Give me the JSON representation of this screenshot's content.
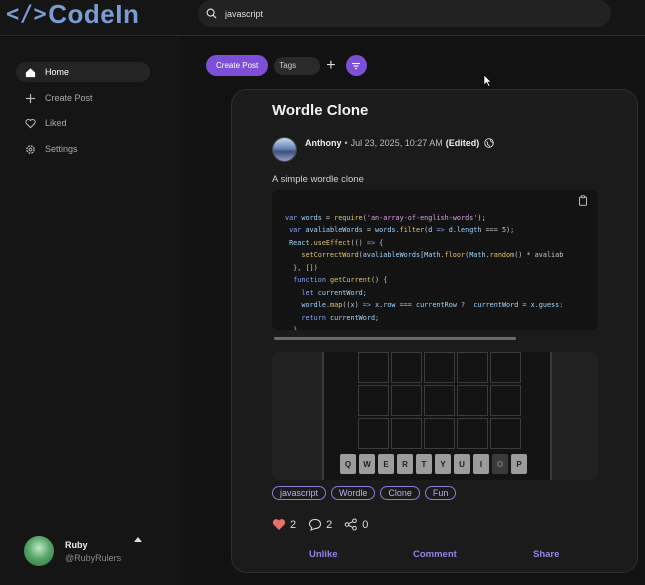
{
  "app": {
    "logo_text": "CodeIn",
    "logo_bracket": "</>"
  },
  "search": {
    "value": "javascript"
  },
  "sidebar": {
    "items": [
      {
        "label": "Home",
        "icon": "home-icon",
        "active": true
      },
      {
        "label": "Create Post",
        "icon": "plus-icon"
      },
      {
        "label": "Liked",
        "icon": "heart-icon"
      },
      {
        "label": "Settings",
        "icon": "gear-icon"
      }
    ],
    "user": {
      "name": "Ruby",
      "handle": "@RubyRulers"
    }
  },
  "toolbar": {
    "create_label": "Create Post",
    "tags_label": "Tags",
    "plus_label": "+"
  },
  "post": {
    "title": "Wordle Clone",
    "author": "Anthony",
    "separator": "•",
    "date": "Jul 23, 2025, 10:27 AM",
    "edited": "(Edited)",
    "description": "A simple wordle clone",
    "code_lines": [
      "var words = require('an-array-of-english-words');",
      " var avaliableWords = words.filter(d => d.length === 5);",
      " React.useEffect(() => {",
      "    setCorrectWord(avaliableWords[Math.floor(Math.random() * avaliab",
      "  }, [])",
      "  function getCurrent() {",
      "    let currentWord;",
      "    wordle.map((x) => x.row === currentRow ?  currentWord = x.guess:",
      "    return currentWord;",
      "  }"
    ],
    "keyboard": [
      "Q",
      "W",
      "E",
      "R",
      "T",
      "Y",
      "U",
      "I",
      "O",
      "P"
    ],
    "tags": [
      "javascript",
      "Wordle",
      "Clone",
      "Fun"
    ],
    "likes": "2",
    "comments": "2",
    "shares": "0",
    "actions": {
      "unlike": "Unlike",
      "comment": "Comment",
      "share": "Share"
    }
  },
  "colors": {
    "accent": "#7d4fd6",
    "logo": "#7a9cd4",
    "tag_border": "#8b7ad8",
    "like": "#e8706a"
  }
}
